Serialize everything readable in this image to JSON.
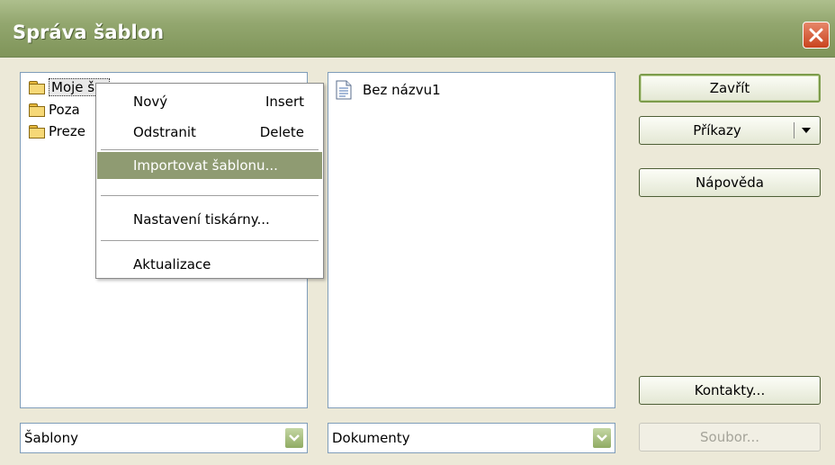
{
  "window": {
    "title": "Správa šablon"
  },
  "left_tree": {
    "items": [
      {
        "label": "Moje š...",
        "selected": true
      },
      {
        "label": "Poza"
      },
      {
        "label": "Preze"
      }
    ]
  },
  "right_list": {
    "items": [
      {
        "label": "Bez názvu1"
      }
    ]
  },
  "context_menu": {
    "items": [
      {
        "label": "Nový",
        "shortcut": "Insert"
      },
      {
        "label": "Odstranit",
        "shortcut": "Delete"
      },
      {
        "label": "Importovat šablonu...",
        "highlighted": true
      },
      {
        "label": "Nastavení tiskárny..."
      },
      {
        "label": "Aktualizace"
      }
    ]
  },
  "buttons": {
    "close": "Zavřít",
    "commands": "Příkazy",
    "help": "Nápověda",
    "contacts": "Kontakty...",
    "file": "Soubor..."
  },
  "combos": {
    "left": "Šablony",
    "right": "Dokumenty"
  },
  "colors": {
    "titlebar": "#93a76f",
    "highlight": "#8f9b72",
    "close_button": "#c9441f"
  }
}
